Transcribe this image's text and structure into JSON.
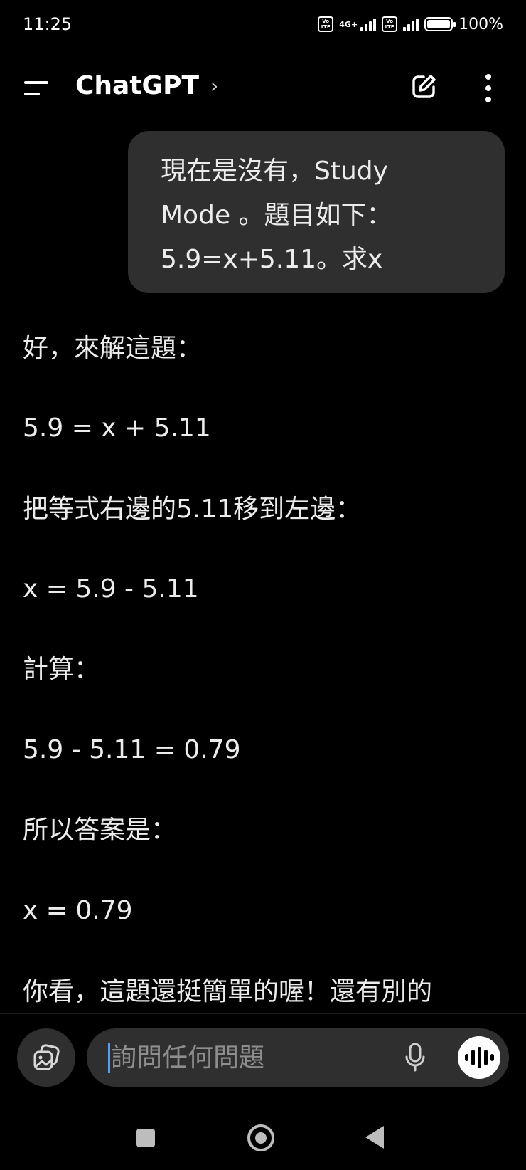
{
  "status_bar": {
    "time": "11:25",
    "sim1_badge": [
      "Vo",
      "LTE"
    ],
    "network_type": "4G+",
    "sim2_badge": [
      "Vo",
      "LTE"
    ],
    "battery_percent_label": "100%",
    "battery_level": 1.0
  },
  "header": {
    "title": "ChatGPT",
    "chevron": "›",
    "icons": [
      "menu-icon",
      "new-chat-icon",
      "more-vertical-icon"
    ]
  },
  "conversation": {
    "user_message_lines": [
      "現在是沒有，Study",
      "Mode 。題目如下：",
      "5.9=x+5.11。求x"
    ],
    "assistant_lines": [
      "好，來解這題：",
      "5.9 = x + 5.11",
      "把等式右邊的5.11移到左邊：",
      "x = 5.9 - 5.11",
      "計算：",
      "5.9 - 5.11 = 0.79",
      "所以答案是：",
      "x = 0.79",
      "你看，這題還挺簡單的喔！還有別的"
    ]
  },
  "composer": {
    "placeholder": "詢問任何問題",
    "value": "",
    "icons": [
      "attach-icon",
      "mic-icon",
      "voice-mode-icon"
    ]
  },
  "nav_bar": {
    "icons": [
      "recents-icon",
      "home-icon",
      "back-icon"
    ]
  }
}
